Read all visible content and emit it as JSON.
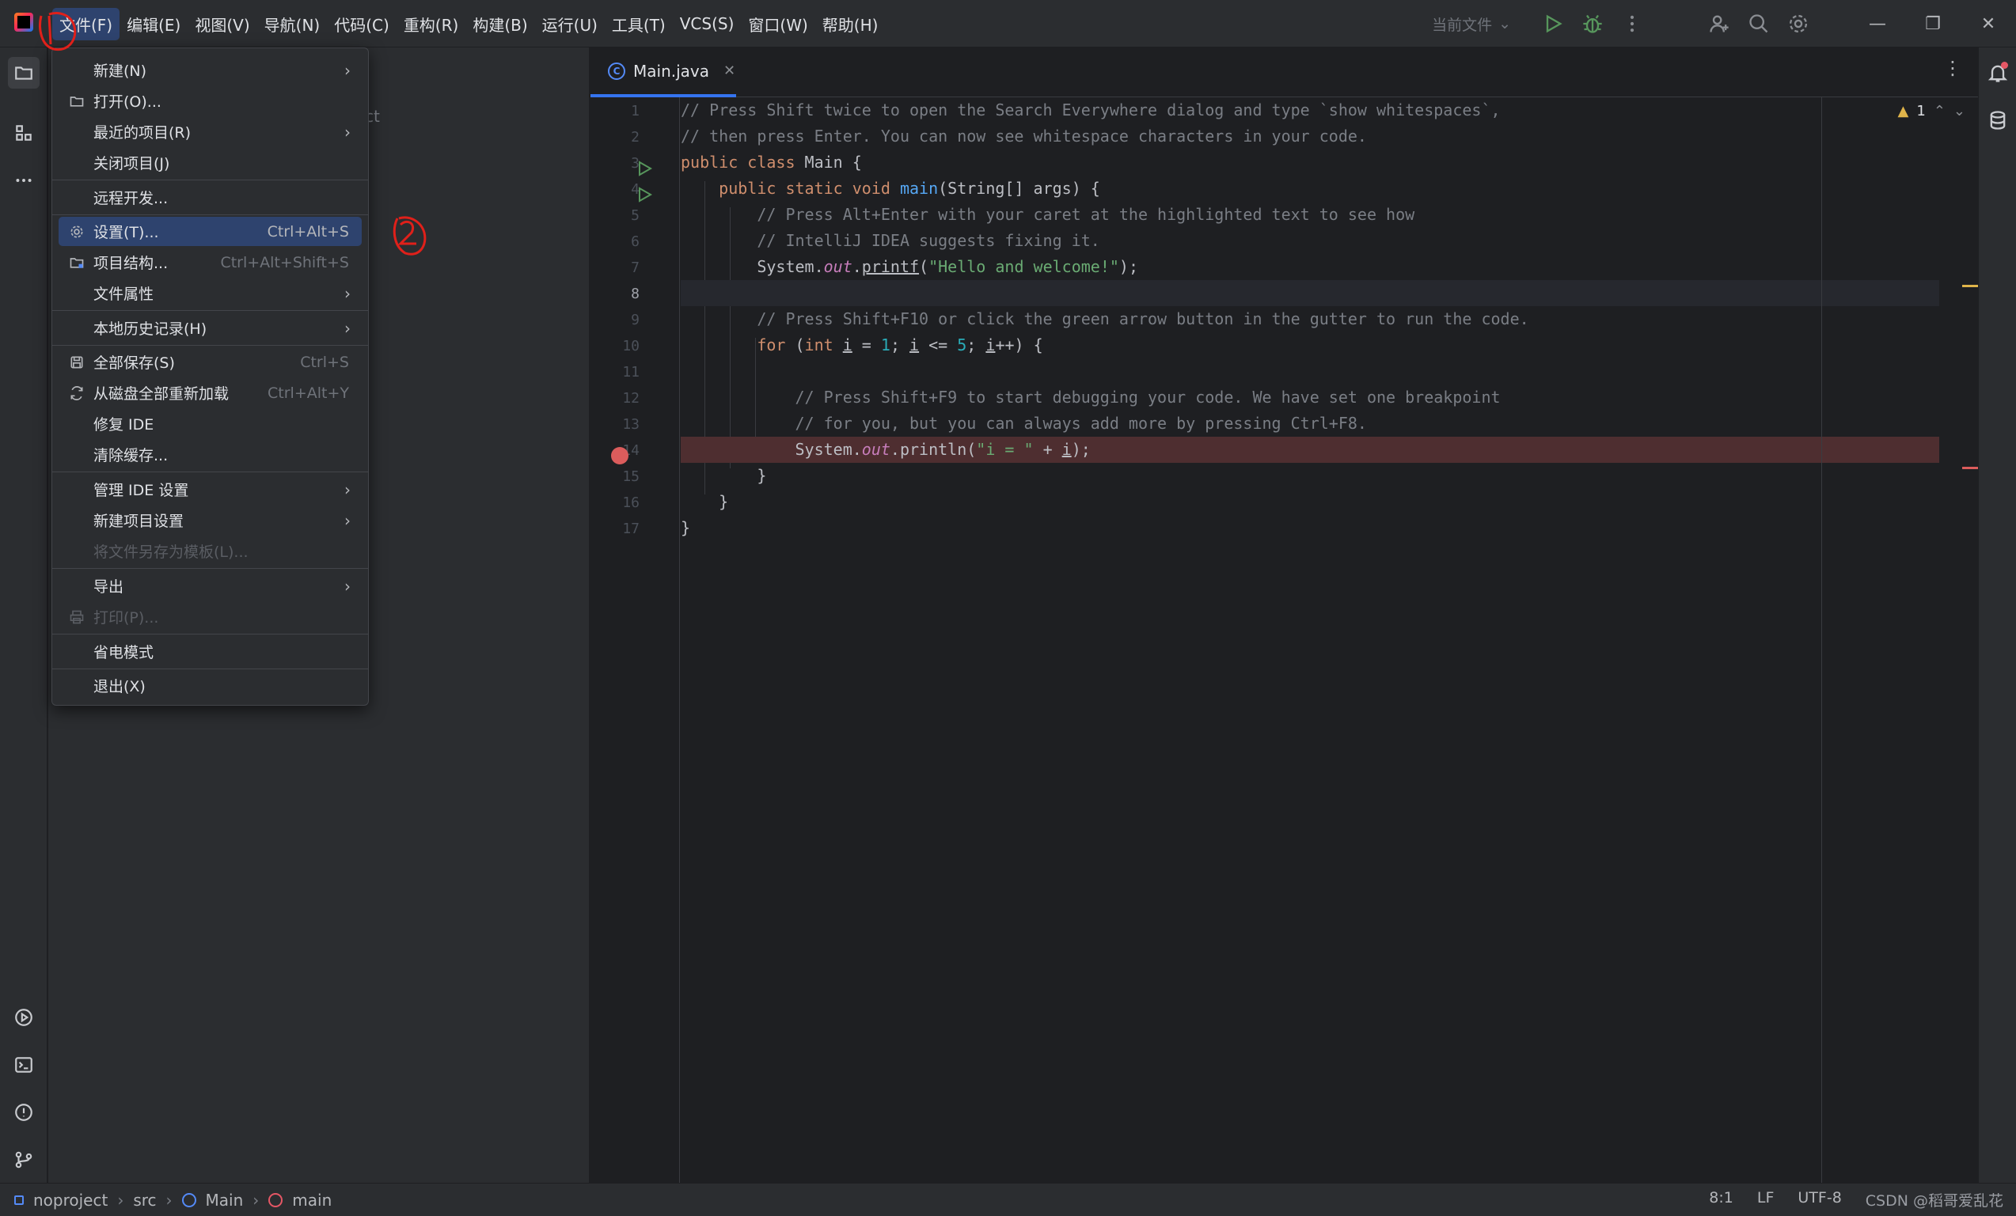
{
  "menubar": {
    "items": [
      "文件(F)",
      "编辑(E)",
      "视图(V)",
      "导航(N)",
      "代码(C)",
      "重构(R)",
      "构建(B)",
      "运行(U)",
      "工具(T)",
      "VCS(S)",
      "窗口(W)",
      "帮助(H)"
    ]
  },
  "toolbar": {
    "run_config": "当前文件",
    "icons": [
      "run-icon",
      "debug-icon",
      "more-icon",
      "add-user-icon",
      "search-icon",
      "settings-icon"
    ]
  },
  "project_panel": {
    "ghost_text": "ct"
  },
  "editor": {
    "tab": {
      "filename": "Main.java",
      "icon": "C"
    },
    "inspection": {
      "warnings": "1"
    },
    "line_numbers": [
      "1",
      "2",
      "3",
      "4",
      "5",
      "6",
      "7",
      "8",
      "9",
      "10",
      "11",
      "12",
      "13",
      "14",
      "15",
      "16",
      "17"
    ],
    "current_line": "8"
  },
  "file_menu": {
    "items": [
      {
        "label": "新建(N)",
        "shortcut": "",
        "submenu": true
      },
      {
        "label": "打开(O)...",
        "shortcut": ""
      },
      {
        "label": "最近的项目(R)",
        "shortcut": "",
        "submenu": true
      },
      {
        "label": "关闭项目(J)",
        "shortcut": ""
      },
      {
        "label": "远程开发...",
        "shortcut": ""
      },
      {
        "label": "设置(T)...",
        "shortcut": "Ctrl+Alt+S"
      },
      {
        "label": "项目结构...",
        "shortcut": "Ctrl+Alt+Shift+S"
      },
      {
        "label": "文件属性",
        "shortcut": "",
        "submenu": true
      },
      {
        "label": "本地历史记录(H)",
        "shortcut": "",
        "submenu": true
      },
      {
        "label": "全部保存(S)",
        "shortcut": "Ctrl+S"
      },
      {
        "label": "从磁盘全部重新加载",
        "shortcut": "Ctrl+Alt+Y"
      },
      {
        "label": "修复 IDE",
        "shortcut": ""
      },
      {
        "label": "清除缓存...",
        "shortcut": ""
      },
      {
        "label": "管理 IDE 设置",
        "shortcut": "",
        "submenu": true
      },
      {
        "label": "新建项目设置",
        "shortcut": "",
        "submenu": true
      },
      {
        "label": "将文件另存为模板(L)...",
        "shortcut": "",
        "disabled": true
      },
      {
        "label": "导出",
        "shortcut": "",
        "submenu": true
      },
      {
        "label": "打印(P)...",
        "shortcut": "",
        "disabled": true
      },
      {
        "label": "省电模式",
        "shortcut": ""
      },
      {
        "label": "退出(X)",
        "shortcut": ""
      }
    ]
  },
  "statusbar": {
    "breadcrumbs": [
      "noproject",
      "src",
      "Main",
      "main"
    ],
    "position": "8:1",
    "line_ending": "LF",
    "encoding": "UTF-8",
    "watermark": "CSDN @稻哥爱乱花"
  },
  "annotations": [
    "1",
    "2"
  ],
  "colors": {
    "accent": "#3574f0",
    "menu_highlight": "#2e436e",
    "breakpoint": "#db5c5c",
    "annotation_red": "#e0201a"
  }
}
